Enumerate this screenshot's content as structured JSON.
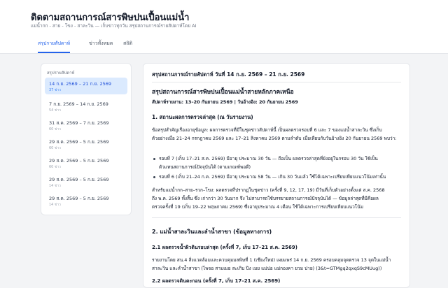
{
  "app": {
    "title": "ติดตามสถานการณ์สารพิษปนเปื้อนแม่น้ำ",
    "subtitle": "แม่น้ำกก - สาย - โขง - สาละวิน — เก็บข่าวทุกวัน สรุปสถานการณ์รายสัปดาห์โดย AI"
  },
  "tabs": [
    {
      "label": "สรุปรายสัปดาห์",
      "active": true
    },
    {
      "label": "ข่าวทั้งหมด",
      "active": false
    },
    {
      "label": "สถิติ",
      "active": false
    }
  ],
  "sidebar": {
    "heading": "สรุปรายสัปดาห์",
    "weeks": [
      {
        "range": "14 ก.ย. 2569 – 21 ก.ย. 2569",
        "count": "37 ข่าว",
        "active": true
      },
      {
        "range": "7 ก.ย. 2569 – 14 ก.ย. 2569",
        "count": "54 ข่าว",
        "active": false
      },
      {
        "range": "31 ส.ค. 2569 – 7 ก.ย. 2569",
        "count": "60 ข่าว",
        "active": false
      },
      {
        "range": "29 ส.ค. 2569 – 5 ก.ย. 2569",
        "count": "60 ข่าว",
        "active": false
      },
      {
        "range": "29 ส.ค. 2569 – 5 ก.ย. 2569",
        "count": "60 ข่าว",
        "active": false
      },
      {
        "range": "29 ส.ค. 2569 – 5 ก.ย. 2569",
        "count": "14 ข่าว",
        "active": false
      },
      {
        "range": "29 ส.ค. 2569 – 5 ก.ย. 2569",
        "count": "14 ข่าว",
        "active": false
      }
    ]
  },
  "summary": {
    "heading": "สรุปสถานการณ์รายสัปดาห์ วันที่ 14 ก.ย. 2569 – 21 ก.ย. 2569",
    "title": "สรุปสถานการณ์สารพิษปนเปื้อนแม่น้ำสายหลักภาคเหนือ",
    "period": "สัปดาห์รายงาน: 13–20 กันยายน 2569 | วันอ้างอิง: 20 กันยายน 2569",
    "s1_heading": "1. สถานะผลการตรวจล่าสุด (ณ วันรายงาน)",
    "s1_p1a": "ข้อสรุปสำคัญเรื่องอายุข้อมูล: ผลการตรวจที่มีในชุดข่าวสัปดาห์นี้ เป็นผลตรวจรอบที่ 6 และ 7 ของแม่น้ำสาละวิน ซึ่งเก็บ",
    "s1_p1b": "ตัวอย่างเมื่อ 21–24 กรกฎาคม 2569 และ 17–21 สิงหาคม 2569 ตามลำดับ เมื่อเทียบกับวันอ้างอิง 20 กันยายน 2569 พบว่า:",
    "b1a": "รอบที่ 7 (เก็บ 17–21 ส.ค. 2569) มีอายุ ประมาณ 30 วัน — ถือเป็น ผลตรวจล่าสุดที่ยังอยู่ในกรอบ 30 วัน ใช้เป็น",
    "b1b": "ตัวแทนสถานการณ์ปัจจุบันได้ (ตามเกณฑ์พอดี)",
    "b2a": "รอบที่ 6 (เก็บ 21–24 ก.ค. 2569) มีอายุ ประมาณ 58 วัน — เกิน 30 วันแล้ว ใช้ได้เฉพาะเปรียบเทียบแนวโน้มเท่านั้น",
    "s1_p2a": "สำหรับแม่น้ำกก–สาย–รวก–โขง: ผลตรวจที่ปรากฏในชุดข่าว (ครั้งที่ 9, 12, 17, 19) มีวันที่เก็บตัวอย่างตั้งแต่ ส.ค. 2568",
    "s1_p2b": "ถึง พ.ค. 2569 ทั้งสิ้น ซึ่ง เก่ากว่า 30 วันมาก จึง ไม่สามารถใช้บรรยายสถานการณ์ปัจจุบันได้ — ข้อมูลล่าสุดที่มีคือผล",
    "s1_p2c": "ตรวจครั้งที่ 19 (เก็บ 19–22 พฤษภาคม 2569) ซึ่งอายุประมาณ 4 เดือน ใช้ได้เฉพาะการเปรียบเทียบแนวโน้ม",
    "s2_heading": "2. แม่น้ำสาละวินและลำน้ำสาขา (ข้อมูลทางการ)",
    "s21_heading": "2.1 ผลตรวจน้ำผิวดินรอบล่าสุด (ครั้งที่ 7, เก็บ 17–21 ส.ค. 2569)",
    "s21_p1a": "รายงานโดย สน.4 สิ่งแวดล้อมและควบคุมมลพิษที่ 1 (เชียงใหม่) เผยแพร่ 14 ก.ย. 2569 ครอบคลุมจุดตรวจ 13 จุดในแม่น้ำ",
    "s21_p1b": "สาละวิน และลำน้ำสาขา (ไพจอ สามเมย สะเกิบ ปิง เมย แม่ปอ แม่กองคา ยวม ปาย) (3&t=GTMgq2qxqS9cMUug))",
    "s22_heading": "2.2 ผลตรวจดินตะกอน (ครั้งที่ 7, เก็บ 17–21 ส.ค. 2569)"
  },
  "colors": {
    "accent": "#2563eb",
    "active_bg": "#dbeafe"
  }
}
